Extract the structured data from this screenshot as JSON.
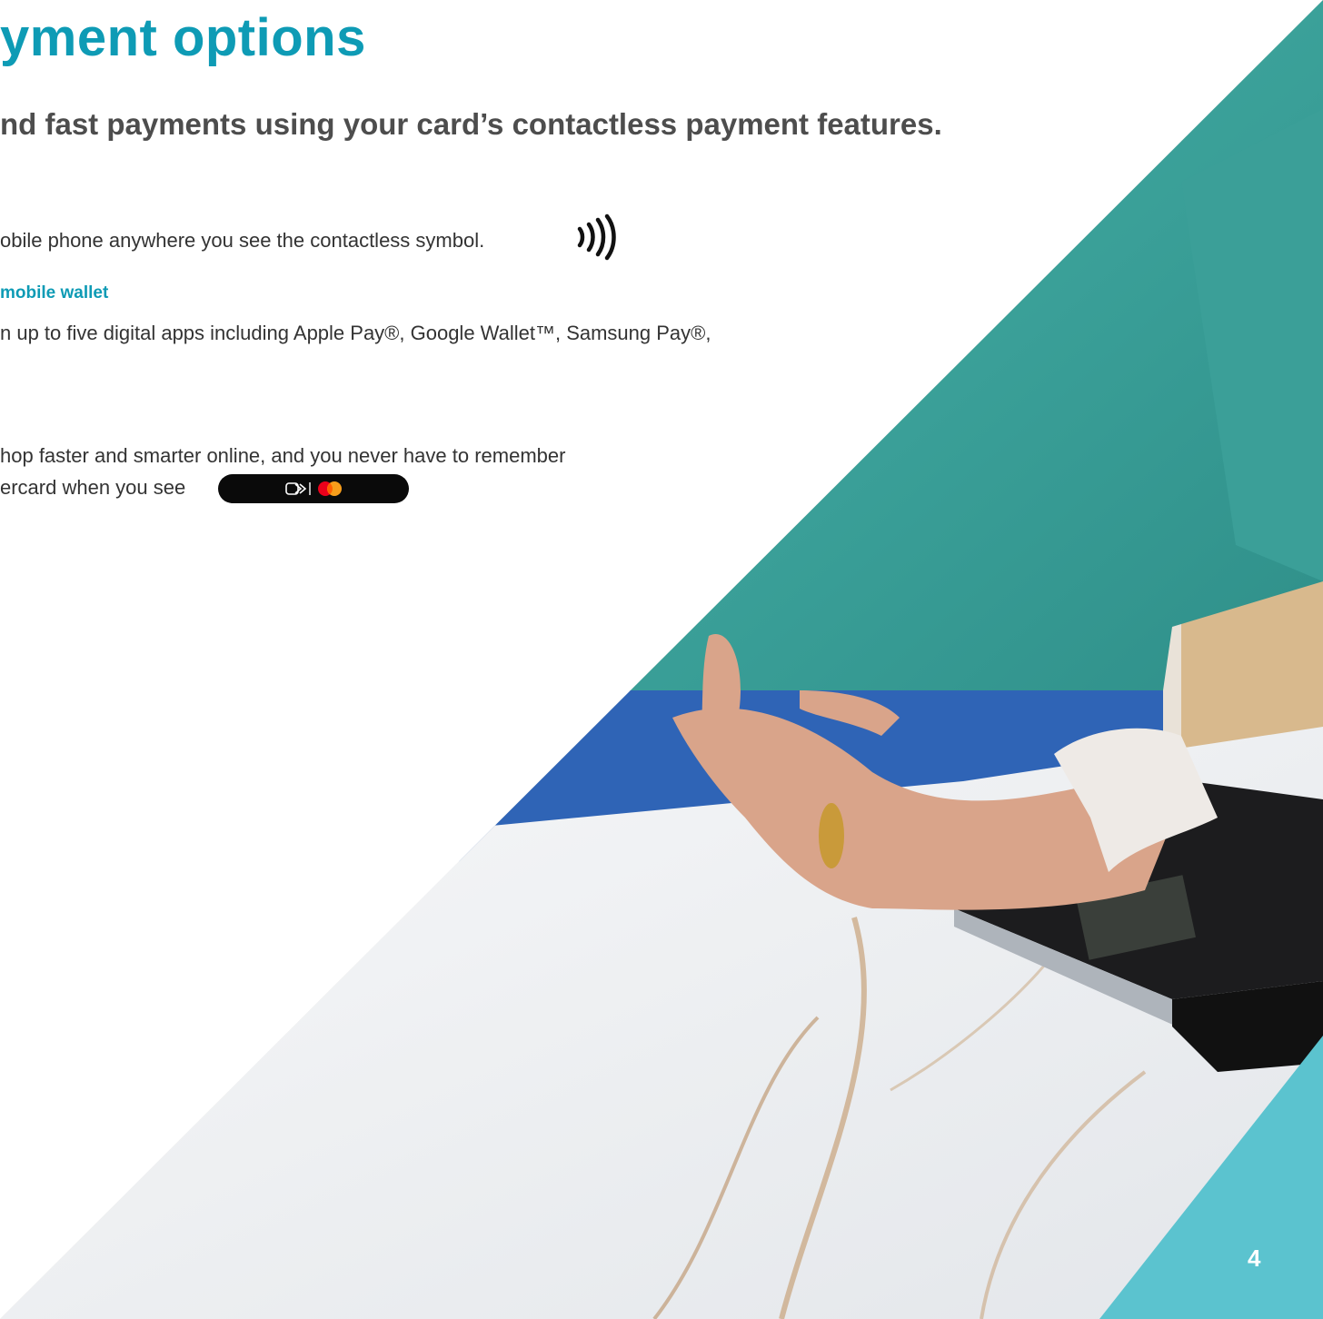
{
  "page": {
    "title": "yment options",
    "subtitle": "nd fast payments using your card’s contactless payment features.",
    "lines": {
      "contactless": "obile phone anywhere you see the contactless symbol.",
      "wallet_heading": "mobile wallet",
      "wallet_body": "n up to five digital apps including Apple Pay®, Google Wallet™, Samsung Pay®,",
      "click_line1": "hop faster and smarter online, and you never have to remember",
      "click_line2": "ercard when you see"
    },
    "page_number": "4"
  },
  "icons": {
    "contactless": "contactless-symbol-icon",
    "click_to_pay": "click-to-pay-icon",
    "mastercard": "mastercard-logo-icon"
  },
  "colors": {
    "accent": "#0e9bb5",
    "corner": "#5bc3cf",
    "sweater": "#3fa7a0",
    "marble": "#eef0f2",
    "jeans": "#2f64b6",
    "text": "#333333"
  },
  "image": {
    "description": "Photo of a hand wearing a smartwatch tapping a card terminal on a marble countertop"
  }
}
